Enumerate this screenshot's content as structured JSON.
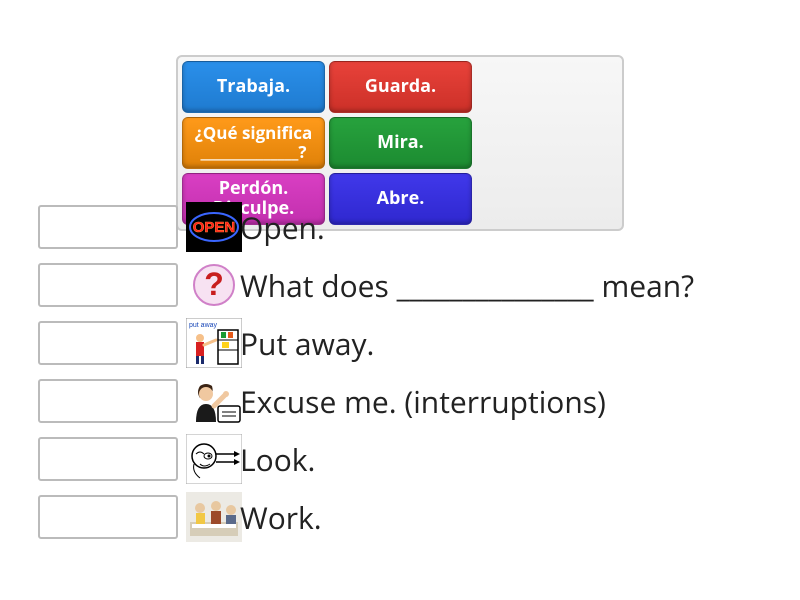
{
  "cards": [
    {
      "label": "Trabaja.",
      "color": "blue"
    },
    {
      "label": "Guarda.",
      "color": "red"
    },
    {
      "label": "¿Qué significa ______________?",
      "color": "orange",
      "small": true
    },
    {
      "label": "Mira.",
      "color": "green"
    },
    {
      "label": "Perdón. Disculpe.",
      "color": "magenta"
    },
    {
      "label": "Abre.",
      "color": "royal"
    }
  ],
  "rows": [
    {
      "icon": "open-sign",
      "text": "Open."
    },
    {
      "icon": "question-mark",
      "text": "What does _______________ mean?"
    },
    {
      "icon": "put-away",
      "text": "Put away."
    },
    {
      "icon": "excuse-me",
      "text": " Excuse me. (interruptions)"
    },
    {
      "icon": "look",
      "text": "Look."
    },
    {
      "icon": "work",
      "text": "Work."
    }
  ]
}
